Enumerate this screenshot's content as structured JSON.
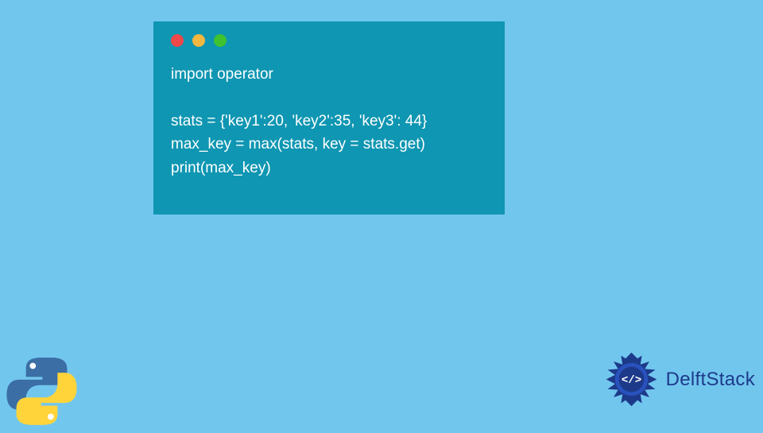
{
  "code": {
    "lines": [
      "import operator",
      "",
      "stats = {'key1':20, 'key2':35, 'key3': 44}",
      "max_key = max(stats, key = stats.get)",
      "print(max_key)"
    ]
  },
  "logos": {
    "python_icon": "python-logo",
    "brand_name": "DelftStack",
    "brand_icon": "delftstack-emblem"
  },
  "window": {
    "traffic_light_colors": [
      "#ef4848",
      "#f4b740",
      "#3ec230"
    ]
  }
}
